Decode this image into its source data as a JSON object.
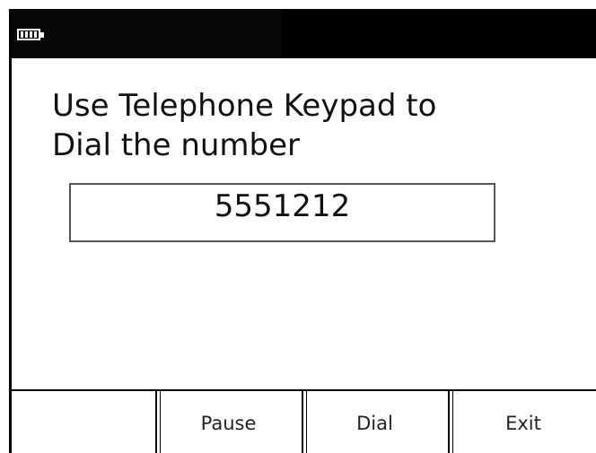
{
  "status_bar": {
    "battery_icon": "battery-icon",
    "background_color": "#000000"
  },
  "prompt": {
    "line1": "Use Telephone Keypad to",
    "line2": "Dial the number"
  },
  "number_field": {
    "value": "5551212"
  },
  "softkeys": [
    {
      "label": ""
    },
    {
      "label": "Pause"
    },
    {
      "label": "Dial"
    },
    {
      "label": "Exit"
    }
  ]
}
